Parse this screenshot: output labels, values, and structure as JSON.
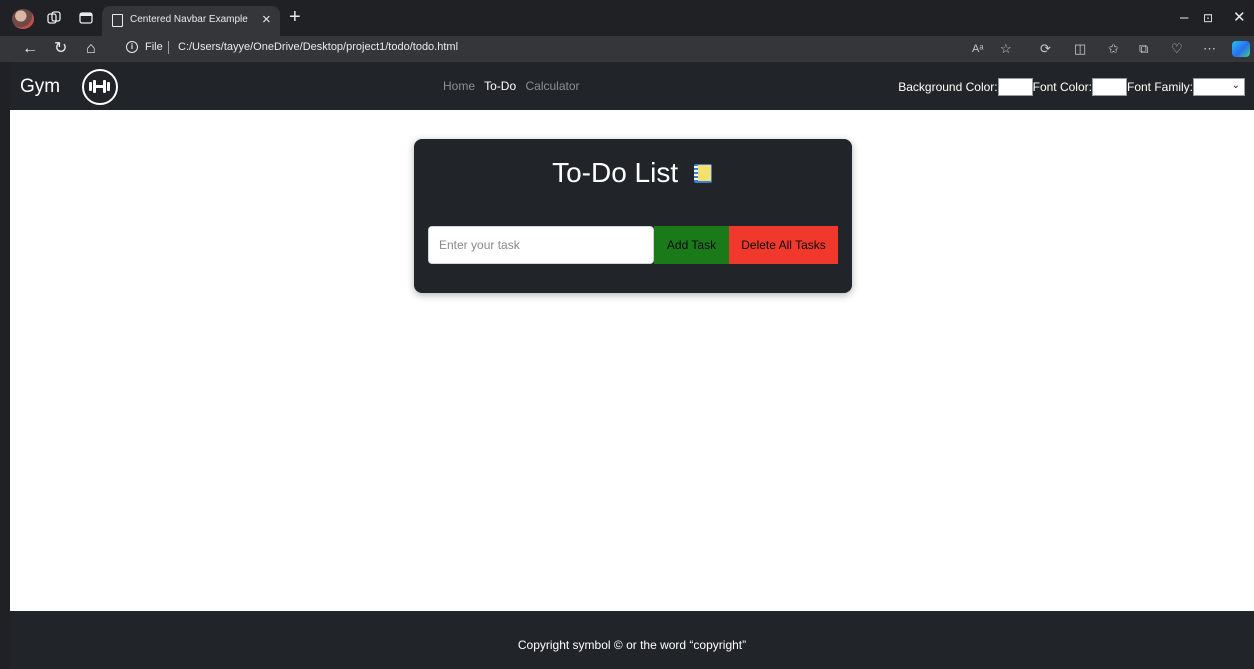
{
  "browser": {
    "tab_title": "Centered Navbar Example",
    "tab_close": "×",
    "new_tab": "+",
    "window_controls": {
      "minimize": "–",
      "restore": "⊡",
      "close": "✕"
    },
    "address": {
      "scheme_label": "File",
      "url": "C:/Users/tayye/OneDrive/Desktop/project1/todo/todo.html"
    },
    "icons": [
      "profile-icon",
      "workspaces-icon",
      "tab-actions-icon",
      "back-icon",
      "refresh-icon",
      "home-icon",
      "read-aloud-icon",
      "favorite-star-icon",
      "extensions-icon",
      "split-screen-icon",
      "favorites-icon",
      "collections-icon",
      "health-icon",
      "more-icon",
      "copilot-icon"
    ]
  },
  "navbar": {
    "brand": "Gym",
    "links": [
      {
        "label": "Home",
        "active": false
      },
      {
        "label": "To-Do",
        "active": true
      },
      {
        "label": "Calculator",
        "active": false
      }
    ],
    "settings": {
      "background_label": "Background Color:",
      "background_value": "#ffffff",
      "font_color_label": "Font Color:",
      "font_color_value": "#ffffff",
      "font_family_label": "Font Family:",
      "font_family_value": ""
    }
  },
  "todo": {
    "title": "To-Do List",
    "input_placeholder": "Enter your task",
    "input_value": "",
    "add_label": "Add Task",
    "delete_label": "Delete All Tasks"
  },
  "footer": {
    "text": "Copyright symbol © or the word “copyright”"
  },
  "colors": {
    "navbar_bg": "#212529",
    "page_bg": "#ffffff",
    "add_button": "#1a7a1a",
    "delete_button": "#f0392c",
    "nav_active": "#ffffff",
    "nav_inactive": "#8c9096"
  }
}
